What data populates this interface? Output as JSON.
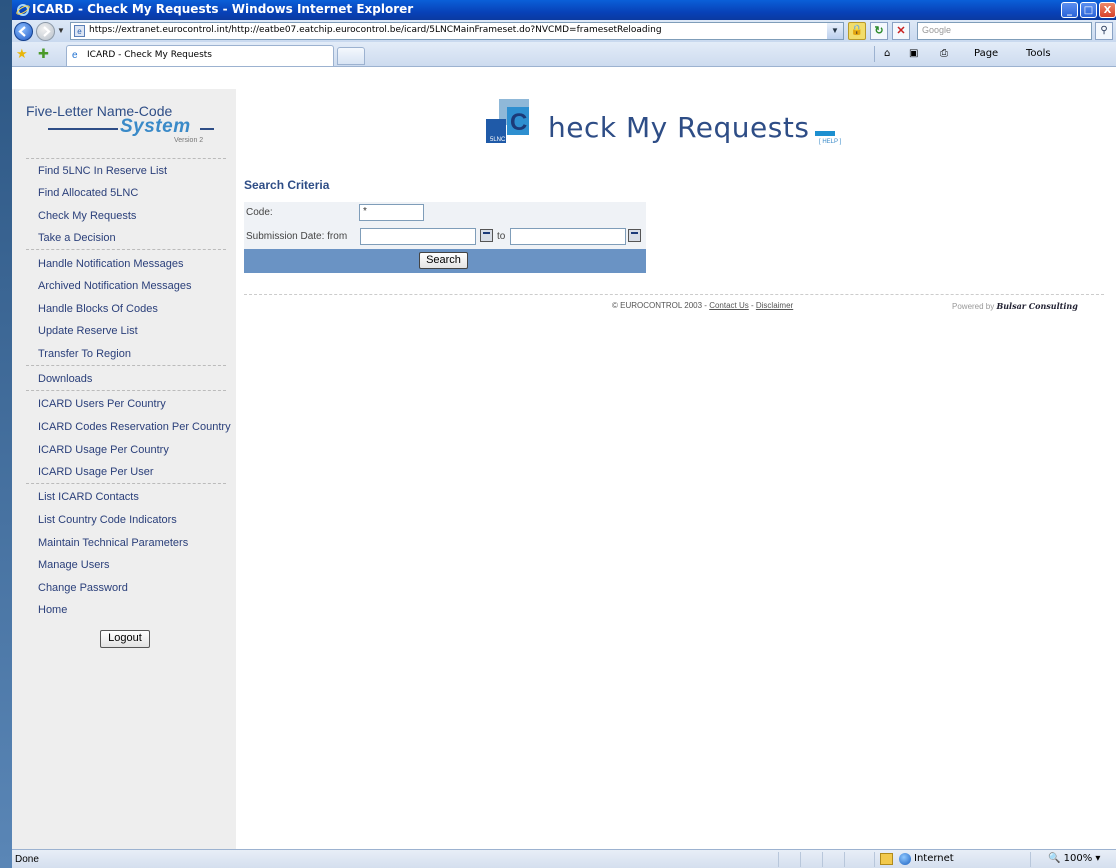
{
  "window": {
    "title": "ICARD - Check My Requests - Windows Internet Explorer",
    "min_label": "_",
    "max_label": "□",
    "close_label": "X"
  },
  "address": {
    "url": "https://extranet.eurocontrol.int/http://eatbe07.eatchip.eurocontrol.be/icard/5LNCMainFrameset.do?NVCMD=framesetReloading",
    "search_placeholder": "Google"
  },
  "tabs": {
    "active": "ICARD - Check My Requests"
  },
  "commands": {
    "home": "⌂",
    "feeds": "▣",
    "print": "⎙",
    "page": "Page",
    "tools": "Tools"
  },
  "logo": {
    "line1": "Five-Letter Name-Code",
    "line2": "System",
    "version": "Version 2"
  },
  "nav": {
    "items": [
      "Find 5LNC In Reserve List",
      "Find Allocated 5LNC",
      "Check My Requests",
      "Take a Decision",
      "Handle Notification Messages",
      "Archived Notification Messages",
      "Handle Blocks Of Codes",
      "Update Reserve List",
      "Transfer To Region",
      "Downloads",
      "ICARD Users Per Country",
      "ICARD Codes Reservation Per Country",
      "ICARD Usage Per Country",
      "ICARD Usage Per User",
      "List ICARD Contacts",
      "List Country Code Indicators",
      "Maintain Technical Parameters",
      "Manage Users",
      "Change Password",
      "Home"
    ],
    "logout": "Logout"
  },
  "header": {
    "badge": "5LNC",
    "initial": "C",
    "title_rest": "heck My Requests",
    "help": "[ HELP ]"
  },
  "search": {
    "section_title": "Search Criteria",
    "code_label": "Code:",
    "code_value": "*",
    "date_label": "Submission Date: from",
    "to_label": "to",
    "date_from": "",
    "date_to": "",
    "button": "Search"
  },
  "footer": {
    "copyright": "© EUROCONTROL 2003 - ",
    "contact": "Contact Us",
    "dash": " - ",
    "disclaimer": "Disclaimer",
    "powered": "Powered by ",
    "company": "Bulsar Consulting"
  },
  "status": {
    "left": "Done",
    "zone": "Internet",
    "zoom": "100%"
  },
  "colors": {
    "titlebar": "#0842b8",
    "sidebar_bg": "#eeeeee",
    "link": "#2a3f7a",
    "header_blue": "#2e4d86",
    "form_bar": "#6a93c4"
  }
}
